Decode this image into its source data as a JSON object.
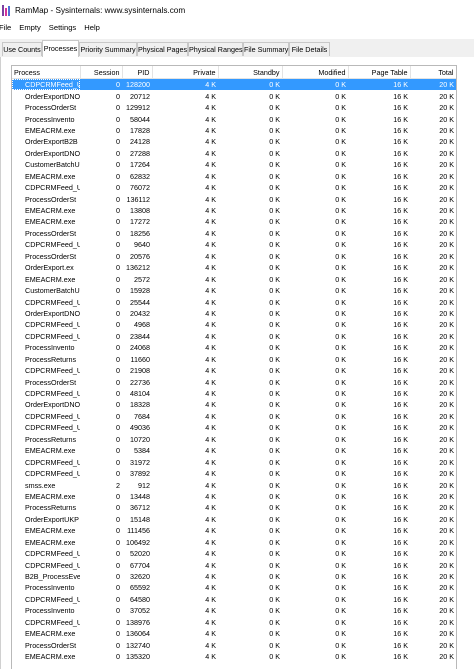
{
  "window": {
    "title": "RamMap - Sysinternals: www.sysinternals.com"
  },
  "menu": [
    "File",
    "Empty",
    "Settings",
    "Help"
  ],
  "tabs": [
    {
      "label": "Use Counts",
      "active": false
    },
    {
      "label": "Processes",
      "active": true
    },
    {
      "label": "Priority Summary",
      "active": false
    },
    {
      "label": "Physical Pages",
      "active": false
    },
    {
      "label": "Physical Ranges",
      "active": false
    },
    {
      "label": "File Summary",
      "active": false
    },
    {
      "label": "File Details",
      "active": false
    }
  ],
  "table": {
    "columns": [
      "Process",
      "Session",
      "PID",
      "Private",
      "Standby",
      "Modified",
      "Page Table",
      "Total"
    ],
    "sorted_column": "Private",
    "rows": [
      [
        "CDPCRMFeed_UK..",
        "0",
        "128200",
        "4 K",
        "0 K",
        "0 K",
        "16 K",
        "20 K"
      ],
      [
        "OrderExportDNO",
        "0",
        "20712",
        "4 K",
        "0 K",
        "0 K",
        "16 K",
        "20 K"
      ],
      [
        "ProcessOrderSt",
        "0",
        "129912",
        "4 K",
        "0 K",
        "0 K",
        "16 K",
        "20 K"
      ],
      [
        "ProcessInvento",
        "0",
        "58044",
        "4 K",
        "0 K",
        "0 K",
        "16 K",
        "20 K"
      ],
      [
        "EMEACRM.exe",
        "0",
        "17828",
        "4 K",
        "0 K",
        "0 K",
        "16 K",
        "20 K"
      ],
      [
        "OrderExportB2B",
        "0",
        "24128",
        "4 K",
        "0 K",
        "0 K",
        "16 K",
        "20 K"
      ],
      [
        "OrderExportDNO",
        "0",
        "27288",
        "4 K",
        "0 K",
        "0 K",
        "16 K",
        "20 K"
      ],
      [
        "CustomerBatchU",
        "0",
        "17264",
        "4 K",
        "0 K",
        "0 K",
        "16 K",
        "20 K"
      ],
      [
        "EMEACRM.exe",
        "0",
        "62832",
        "4 K",
        "0 K",
        "0 K",
        "16 K",
        "20 K"
      ],
      [
        "CDPCRMFeed_UK..",
        "0",
        "76072",
        "4 K",
        "0 K",
        "0 K",
        "16 K",
        "20 K"
      ],
      [
        "ProcessOrderSt",
        "0",
        "136112",
        "4 K",
        "0 K",
        "0 K",
        "16 K",
        "20 K"
      ],
      [
        "EMEACRM.exe",
        "0",
        "13808",
        "4 K",
        "0 K",
        "0 K",
        "16 K",
        "20 K"
      ],
      [
        "EMEACRM.exe",
        "0",
        "17272",
        "4 K",
        "0 K",
        "0 K",
        "16 K",
        "20 K"
      ],
      [
        "ProcessOrderSt",
        "0",
        "18256",
        "4 K",
        "0 K",
        "0 K",
        "16 K",
        "20 K"
      ],
      [
        "CDPCRMFeed_UK..",
        "0",
        "9640",
        "4 K",
        "0 K",
        "0 K",
        "16 K",
        "20 K"
      ],
      [
        "ProcessOrderSt",
        "0",
        "20576",
        "4 K",
        "0 K",
        "0 K",
        "16 K",
        "20 K"
      ],
      [
        "OrderExport.ex",
        "0",
        "136212",
        "4 K",
        "0 K",
        "0 K",
        "16 K",
        "20 K"
      ],
      [
        "EMEACRM.exe",
        "0",
        "2572",
        "4 K",
        "0 K",
        "0 K",
        "16 K",
        "20 K"
      ],
      [
        "CustomerBatchU",
        "0",
        "15928",
        "4 K",
        "0 K",
        "0 K",
        "16 K",
        "20 K"
      ],
      [
        "CDPCRMFeed_UK..",
        "0",
        "25544",
        "4 K",
        "0 K",
        "0 K",
        "16 K",
        "20 K"
      ],
      [
        "OrderExportDNO",
        "0",
        "20432",
        "4 K",
        "0 K",
        "0 K",
        "16 K",
        "20 K"
      ],
      [
        "CDPCRMFeed_UK..",
        "0",
        "4968",
        "4 K",
        "0 K",
        "0 K",
        "16 K",
        "20 K"
      ],
      [
        "CDPCRMFeed_UK..",
        "0",
        "23844",
        "4 K",
        "0 K",
        "0 K",
        "16 K",
        "20 K"
      ],
      [
        "ProcessInvento",
        "0",
        "24068",
        "4 K",
        "0 K",
        "0 K",
        "16 K",
        "20 K"
      ],
      [
        "ProcessReturns",
        "0",
        "11660",
        "4 K",
        "0 K",
        "0 K",
        "16 K",
        "20 K"
      ],
      [
        "CDPCRMFeed_UK..",
        "0",
        "21908",
        "4 K",
        "0 K",
        "0 K",
        "16 K",
        "20 K"
      ],
      [
        "ProcessOrderSt",
        "0",
        "22736",
        "4 K",
        "0 K",
        "0 K",
        "16 K",
        "20 K"
      ],
      [
        "CDPCRMFeed_UK..",
        "0",
        "48104",
        "4 K",
        "0 K",
        "0 K",
        "16 K",
        "20 K"
      ],
      [
        "OrderExportDNO",
        "0",
        "18328",
        "4 K",
        "0 K",
        "0 K",
        "16 K",
        "20 K"
      ],
      [
        "CDPCRMFeed_UK..",
        "0",
        "7684",
        "4 K",
        "0 K",
        "0 K",
        "16 K",
        "20 K"
      ],
      [
        "CDPCRMFeed_UK..",
        "0",
        "49036",
        "4 K",
        "0 K",
        "0 K",
        "16 K",
        "20 K"
      ],
      [
        "ProcessReturns",
        "0",
        "10720",
        "4 K",
        "0 K",
        "0 K",
        "16 K",
        "20 K"
      ],
      [
        "EMEACRM.exe",
        "0",
        "5384",
        "4 K",
        "0 K",
        "0 K",
        "16 K",
        "20 K"
      ],
      [
        "CDPCRMFeed_UK..",
        "0",
        "31972",
        "4 K",
        "0 K",
        "0 K",
        "16 K",
        "20 K"
      ],
      [
        "CDPCRMFeed_UK..",
        "0",
        "37892",
        "4 K",
        "0 K",
        "0 K",
        "16 K",
        "20 K"
      ],
      [
        "smss.exe",
        "2",
        "912",
        "4 K",
        "0 K",
        "0 K",
        "16 K",
        "20 K"
      ],
      [
        "EMEACRM.exe",
        "0",
        "13448",
        "4 K",
        "0 K",
        "0 K",
        "16 K",
        "20 K"
      ],
      [
        "ProcessReturns",
        "0",
        "36712",
        "4 K",
        "0 K",
        "0 K",
        "16 K",
        "20 K"
      ],
      [
        "OrderExportUKP",
        "0",
        "15148",
        "4 K",
        "0 K",
        "0 K",
        "16 K",
        "20 K"
      ],
      [
        "EMEACRM.exe",
        "0",
        "111456",
        "4 K",
        "0 K",
        "0 K",
        "16 K",
        "20 K"
      ],
      [
        "EMEACRM.exe",
        "0",
        "106492",
        "4 K",
        "0 K",
        "0 K",
        "16 K",
        "20 K"
      ],
      [
        "CDPCRMFeed_UK..",
        "0",
        "52020",
        "4 K",
        "0 K",
        "0 K",
        "16 K",
        "20 K"
      ],
      [
        "CDPCRMFeed_UK..",
        "0",
        "67704",
        "4 K",
        "0 K",
        "0 K",
        "16 K",
        "20 K"
      ],
      [
        "B2B_ProcessEve",
        "0",
        "32620",
        "4 K",
        "0 K",
        "0 K",
        "16 K",
        "20 K"
      ],
      [
        "ProcessInvento",
        "0",
        "65592",
        "4 K",
        "0 K",
        "0 K",
        "16 K",
        "20 K"
      ],
      [
        "CDPCRMFeed_UK..",
        "0",
        "64580",
        "4 K",
        "0 K",
        "0 K",
        "16 K",
        "20 K"
      ],
      [
        "ProcessInvento",
        "0",
        "37052",
        "4 K",
        "0 K",
        "0 K",
        "16 K",
        "20 K"
      ],
      [
        "CDPCRMFeed_UK..",
        "0",
        "138976",
        "4 K",
        "0 K",
        "0 K",
        "16 K",
        "20 K"
      ],
      [
        "EMEACRM.exe",
        "0",
        "136064",
        "4 K",
        "0 K",
        "0 K",
        "16 K",
        "20 K"
      ],
      [
        "ProcessOrderSt",
        "0",
        "132740",
        "4 K",
        "0 K",
        "0 K",
        "16 K",
        "20 K"
      ],
      [
        "EMEACRM.exe",
        "0",
        "135320",
        "4 K",
        "0 K",
        "0 K",
        "16 K",
        "20 K"
      ]
    ],
    "selected_row": 0
  },
  "colors": {
    "selection": "#3399ff",
    "selection_text": "#ffffff"
  }
}
